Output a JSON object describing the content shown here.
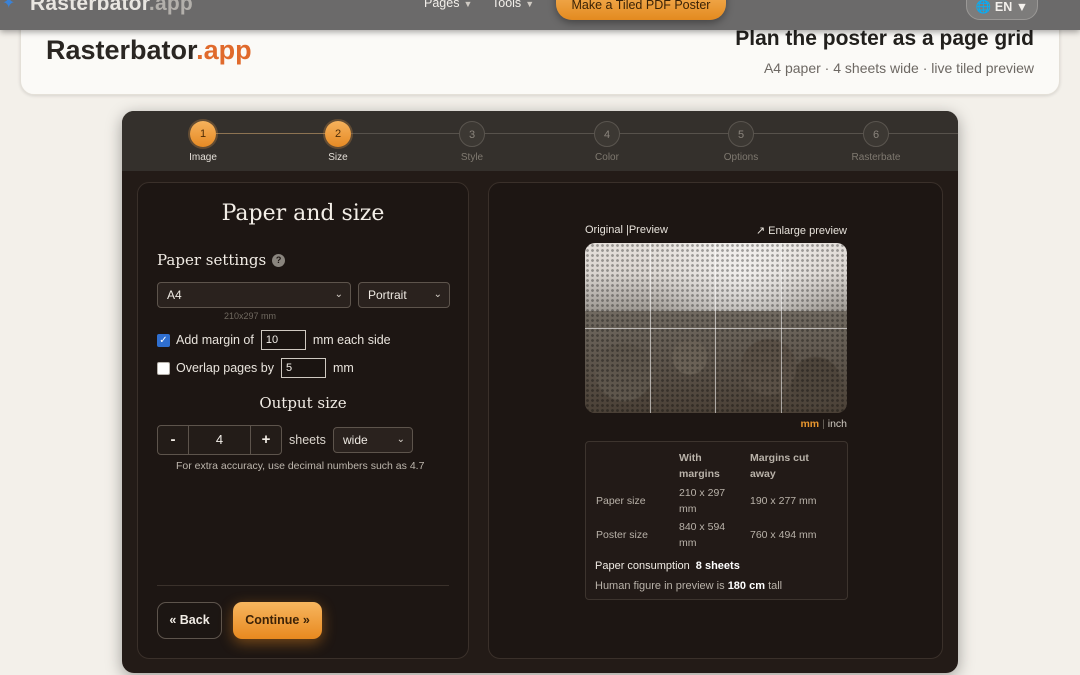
{
  "nav": {
    "brand_main": "Rasterbator",
    "brand_suffix": ".app",
    "links": [
      {
        "label": "Pages"
      },
      {
        "label": "Tools"
      }
    ],
    "cta": "Make a Tiled PDF Poster",
    "lang": "EN"
  },
  "header": {
    "brand_main": "Rasterbator",
    "brand_accent": ".app",
    "title": "Plan the poster as a page grid",
    "subtitle": "A4 paper · 4 sheets wide · live tiled preview"
  },
  "steps": [
    {
      "num": "1",
      "label": "Image",
      "active": true
    },
    {
      "num": "2",
      "label": "Size",
      "active": true
    },
    {
      "num": "3",
      "label": "Style",
      "active": false
    },
    {
      "num": "4",
      "label": "Color",
      "active": false
    },
    {
      "num": "5",
      "label": "Options",
      "active": false
    },
    {
      "num": "6",
      "label": "Rasterbate",
      "active": false
    }
  ],
  "left": {
    "title": "Paper and size",
    "paper_settings_title": "Paper settings",
    "help_icon": "?",
    "paper_select": "A4",
    "orientation_select": "Portrait",
    "paper_dims": "210x297 mm",
    "margin": {
      "checked": true,
      "label_before": "Add margin of",
      "value": "10",
      "label_after": "mm each side"
    },
    "overlap": {
      "checked": false,
      "label_before": "Overlap pages by",
      "value": "5",
      "label_after": "mm"
    },
    "output_title": "Output size",
    "stepper": {
      "minus": "-",
      "value": "4",
      "plus": "+"
    },
    "sheets_label": "sheets",
    "dimension_select": "wide",
    "accuracy_hint": "For extra accuracy, use decimal numbers such as 4.7",
    "back_button": "« Back",
    "continue_button": "Continue »"
  },
  "right": {
    "tab_original": "Original",
    "tab_sep": "|",
    "tab_preview": "Preview",
    "enlarge": "Enlarge preview",
    "unit_on": "mm",
    "unit_sep": "|",
    "unit_off": "inch",
    "table": {
      "col1_header": "With margins",
      "col2_header": "Margins cut away",
      "rows": [
        {
          "label": "Paper size",
          "with": "210 x 297 mm",
          "cut": "190 x 277 mm"
        },
        {
          "label": "Poster size",
          "with": "840 x 594 mm",
          "cut": "760 x 494 mm"
        }
      ]
    },
    "consumption_label": "Paper consumption",
    "consumption_value": "8 sheets",
    "human_label": "Human figure in preview is",
    "human_value": "180 cm",
    "human_suffix": "tall"
  },
  "colors": {
    "accent": "#e8891f",
    "brand_accent": "#e06a2c",
    "panel": "#1d1613",
    "wizard": "#231b17"
  }
}
